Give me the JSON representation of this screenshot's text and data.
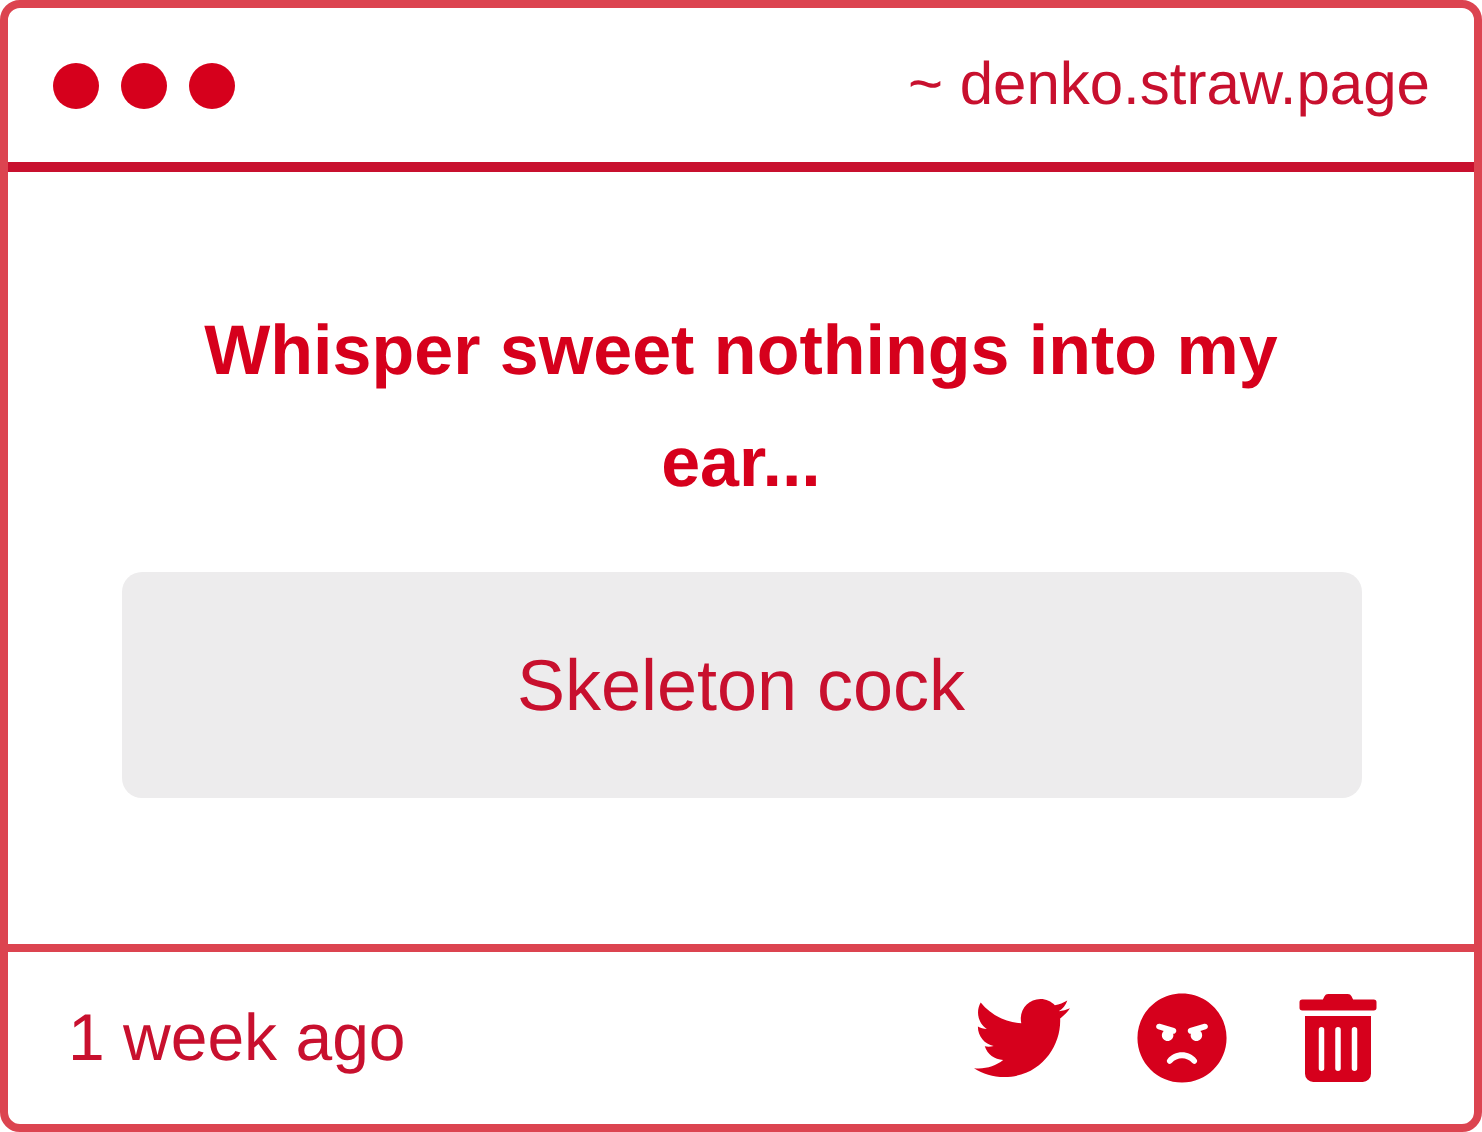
{
  "window": {
    "domain": "~ denko.straw.page"
  },
  "message": {
    "prompt": "Whisper sweet nothings into my ear...",
    "reply": "Skeleton cock"
  },
  "footer": {
    "time": "1 week ago"
  }
}
